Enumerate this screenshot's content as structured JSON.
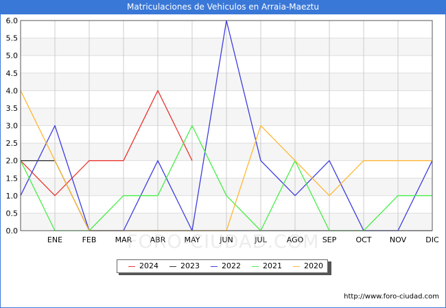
{
  "chart_data": {
    "type": "line",
    "title": "Matriculaciones de Vehiculos en Arraia-Maeztu",
    "xlabel": "",
    "ylabel": "",
    "categories": [
      "",
      "ENE",
      "FEB",
      "MAR",
      "ABR",
      "MAY",
      "JUN",
      "JUL",
      "AGO",
      "SEP",
      "OCT",
      "NOV",
      "DIC"
    ],
    "ylim": [
      0,
      6
    ],
    "yticks": [
      "0.0",
      "0.5",
      "1.0",
      "1.5",
      "2.0",
      "2.5",
      "3.0",
      "3.5",
      "4.0",
      "4.5",
      "5.0",
      "5.5",
      "6.0"
    ],
    "grid": true,
    "legend_position": "bottom-center",
    "series": [
      {
        "name": "2024",
        "color": "#e8342f",
        "values": [
          2,
          1,
          2,
          2,
          4,
          2,
          null,
          null,
          null,
          null,
          null,
          null,
          null
        ]
      },
      {
        "name": "2023",
        "color": "#333333",
        "values": [
          2,
          2,
          0,
          0,
          0,
          0,
          0,
          0,
          0,
          0,
          0,
          0,
          0
        ]
      },
      {
        "name": "2022",
        "color": "#3b3be0",
        "values": [
          1,
          3,
          0,
          0,
          2,
          0,
          6,
          2,
          1,
          2,
          0,
          0,
          2
        ]
      },
      {
        "name": "2021",
        "color": "#44ee44",
        "values": [
          2,
          0,
          0,
          1,
          1,
          3,
          1,
          0,
          2,
          0,
          0,
          1,
          1
        ]
      },
      {
        "name": "2020",
        "color": "#ffb733",
        "values": [
          4,
          2,
          0,
          0,
          0,
          0,
          0,
          3,
          2,
          1,
          2,
          2,
          2
        ]
      }
    ]
  },
  "watermark": "FORO-CIUDAD.COM",
  "source_url": "http://www.foro-ciudad.com"
}
